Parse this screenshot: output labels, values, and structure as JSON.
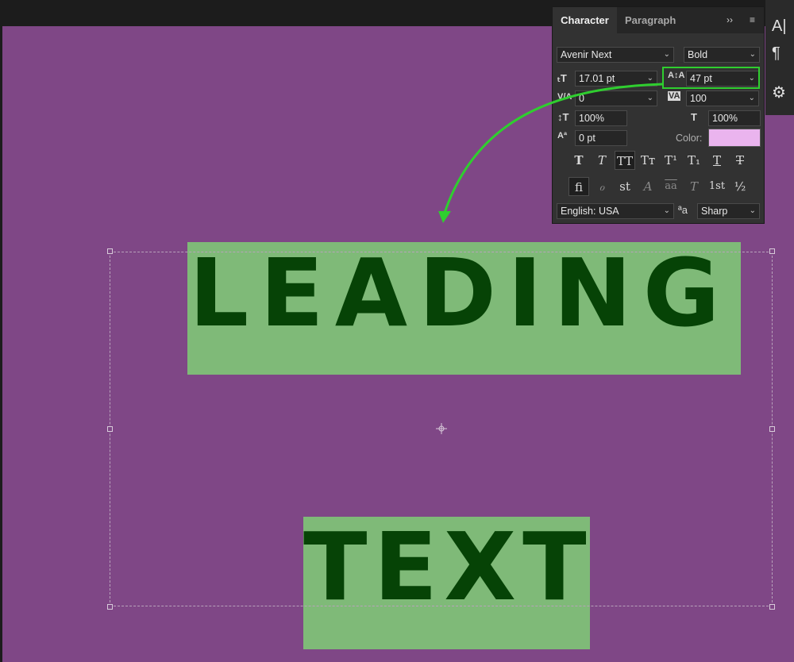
{
  "canvas": {
    "background": "#7f4786",
    "text_line_1": "LEADING",
    "text_line_2": "TEXT",
    "text_color": "#064306",
    "highlight_color": "#7fba78"
  },
  "panel": {
    "tabs": {
      "character": "Character",
      "paragraph": "Paragraph"
    },
    "overflow_icon": "double-chevron-right-icon",
    "menu_icon": "hamburger-menu-icon",
    "font_family": "Avenir Next",
    "font_style": "Bold",
    "font_size": "17.01 pt",
    "leading": "47 pt",
    "kerning": "0",
    "tracking": "100",
    "vertical_scale": "100%",
    "horizontal_scale": "100%",
    "baseline_shift": "0 pt",
    "color_label": "Color:",
    "color_value": "#eab4ee",
    "type_style_buttons": [
      "T",
      "T",
      "TT",
      "Tт",
      "T¹",
      "T₁",
      "T",
      "T"
    ],
    "opentype_buttons": [
      "fi",
      "ℴ",
      "st",
      "A",
      "aa",
      "T",
      "1st",
      "½"
    ],
    "language": "English: USA",
    "antialias_icon": "aa-icon",
    "antialias": "Sharp",
    "accent_highlight": "#2fce2f"
  },
  "side_tools": {
    "icons": [
      "character-panel-icon",
      "paragraph-icon",
      "glyphs-icon"
    ]
  }
}
